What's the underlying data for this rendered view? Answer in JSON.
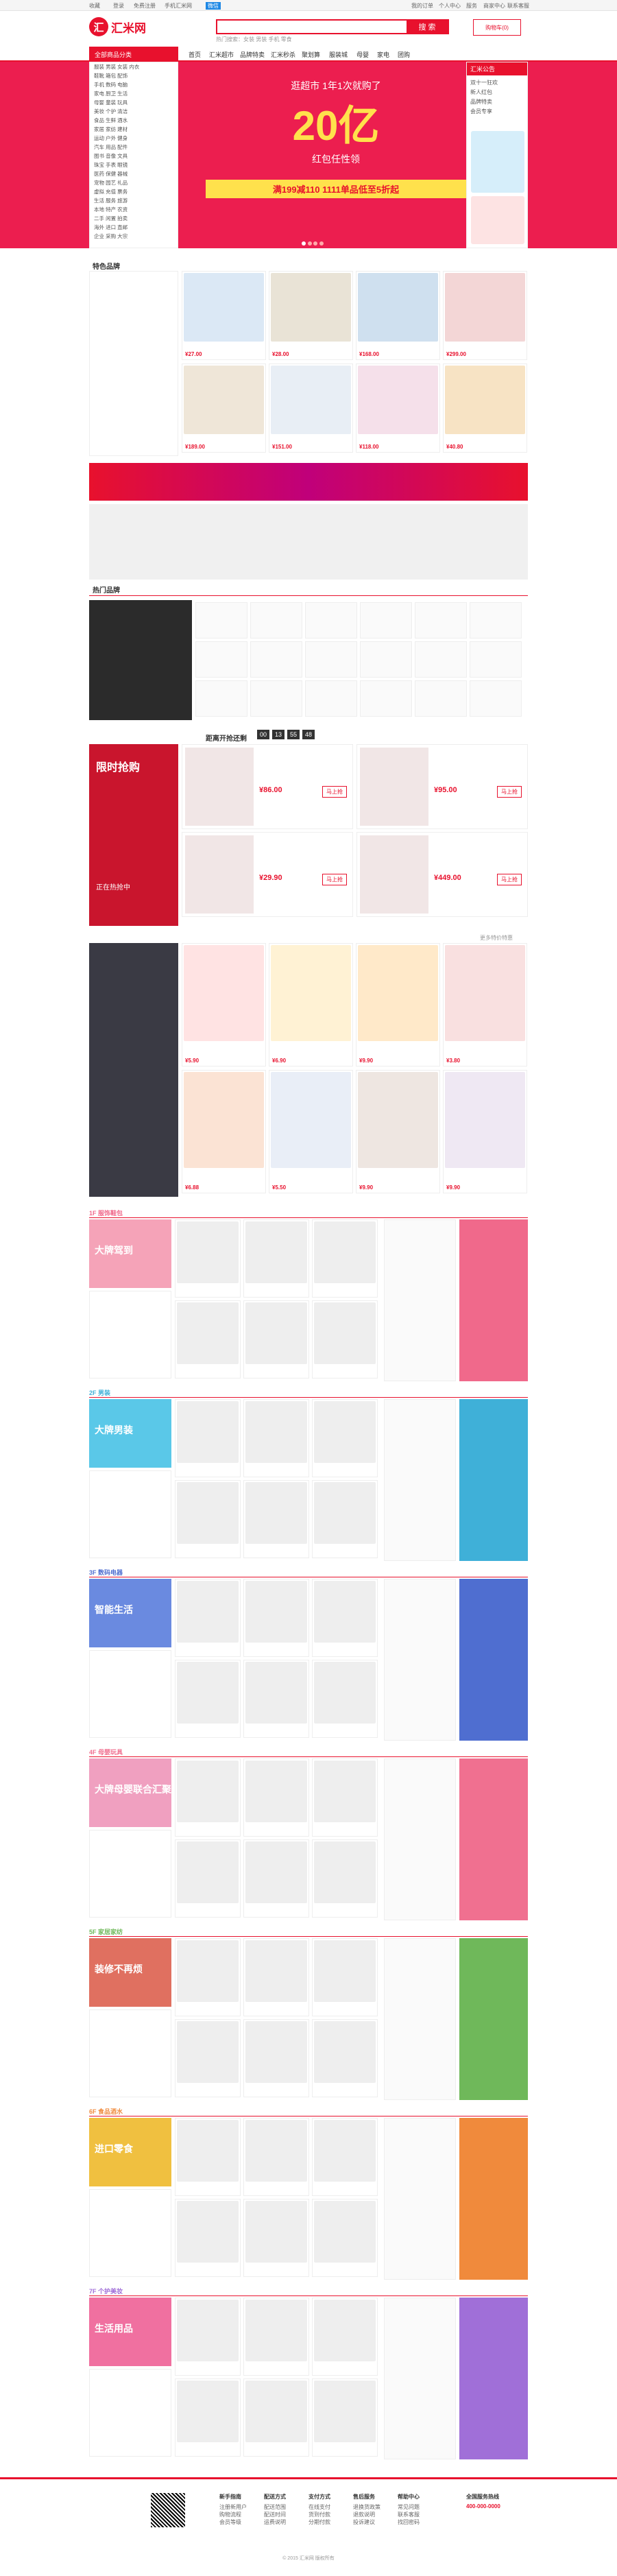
{
  "topbar": {
    "left": [
      "收藏",
      "登录",
      "免费注册",
      "手机汇米网",
      "微信"
    ],
    "right": [
      "我的订单",
      "个人中心",
      "服务",
      "商家中心",
      "联系客服"
    ]
  },
  "header": {
    "logo_mark": "汇",
    "logo_text": "汇米网",
    "search_placeholder": "",
    "search_button": "搜 索",
    "hot_words": "热门搜索：女装 男装 手机 零食",
    "cart": "购物车(0)"
  },
  "nav": {
    "all": "全部商品分类",
    "items": [
      "首页",
      "汇米超市",
      "品牌特卖",
      "汇米秒杀",
      "聚划算",
      "服装城",
      "母婴",
      "家电",
      "团购"
    ]
  },
  "sidecat": [
    "服装 男装 女装 内衣",
    "鞋靴 箱包 配饰",
    "手机 数码 电脑",
    "家电 厨卫 生活",
    "母婴 童装 玩具",
    "美妆 个护 清洁",
    "食品 生鲜 酒水",
    "家居 家纺 建材",
    "运动 户外 健身",
    "汽车 用品 配件",
    "图书 音像 文具",
    "珠宝 手表 眼镜",
    "医药 保健 器械",
    "宠物 园艺 礼品",
    "虚拟 充值 票务",
    "生活 服务 旅游",
    "本地 特产 农资",
    "二手 闲置 拍卖",
    "海外 进口 直邮",
    "企业 采购 大宗"
  ],
  "banner": {
    "top": "逛超市 1年1次就购了",
    "big": "20亿",
    "sub": "红包任性领",
    "bar": "满199减110 1111单品低至5折起"
  },
  "rightbox": {
    "title": "汇米公告",
    "items": [
      "双十一狂欢",
      "新人红包",
      "品牌特卖",
      "会员专享"
    ]
  },
  "sections": {
    "brand": "特色品牌",
    "hot": "热门品牌",
    "flash": "距离开抢还剩",
    "flash_title": "限时抢购",
    "flash_sub": "正在热抢中",
    "more": "更多特价特惠",
    "floors": [
      "1F 服饰鞋包",
      "2F 男装",
      "3F 数码电器",
      "4F 母婴玩具",
      "5F 家居家纺",
      "6F 食品酒水",
      "7F 个护美妆"
    ],
    "floor_banners": [
      "大牌驾到",
      "大牌男装",
      "智能生活",
      "大牌母婴联合汇聚",
      "装修不再烦",
      "进口零食",
      "生活用品"
    ]
  },
  "prices": [
    "¥27.00",
    "¥28.00",
    "¥168.00",
    "¥299.00",
    "¥189.00",
    "¥151.00",
    "¥118.00",
    "¥40.80",
    "¥86.00",
    "¥95.00",
    "¥29.90",
    "¥449.00",
    "¥5.90",
    "¥6.90",
    "¥9.90",
    "¥3.80",
    "¥6.88",
    "¥5.50",
    "¥9.90",
    "¥9.90"
  ],
  "countdown": [
    "00",
    "13",
    "55",
    "48"
  ],
  "buy": "马上抢",
  "footer": {
    "cols": [
      {
        "t": "新手指南",
        "i": [
          "注册新用户",
          "购物流程",
          "会员等级"
        ]
      },
      {
        "t": "配送方式",
        "i": [
          "配送范围",
          "配送时间",
          "运费说明"
        ]
      },
      {
        "t": "支付方式",
        "i": [
          "在线支付",
          "货到付款",
          "分期付款"
        ]
      },
      {
        "t": "售后服务",
        "i": [
          "退换货政策",
          "退款说明",
          "投诉建议"
        ]
      },
      {
        "t": "帮助中心",
        "i": [
          "常见问题",
          "联系客服",
          "找回密码"
        ]
      }
    ],
    "hotline_title": "全国服务热线",
    "hotline": "400-000-0000",
    "copyright": "© 2015 汇米网 版权所有"
  },
  "colors": {
    "accent": "#e8112d",
    "banner": "#ec1e4f"
  }
}
